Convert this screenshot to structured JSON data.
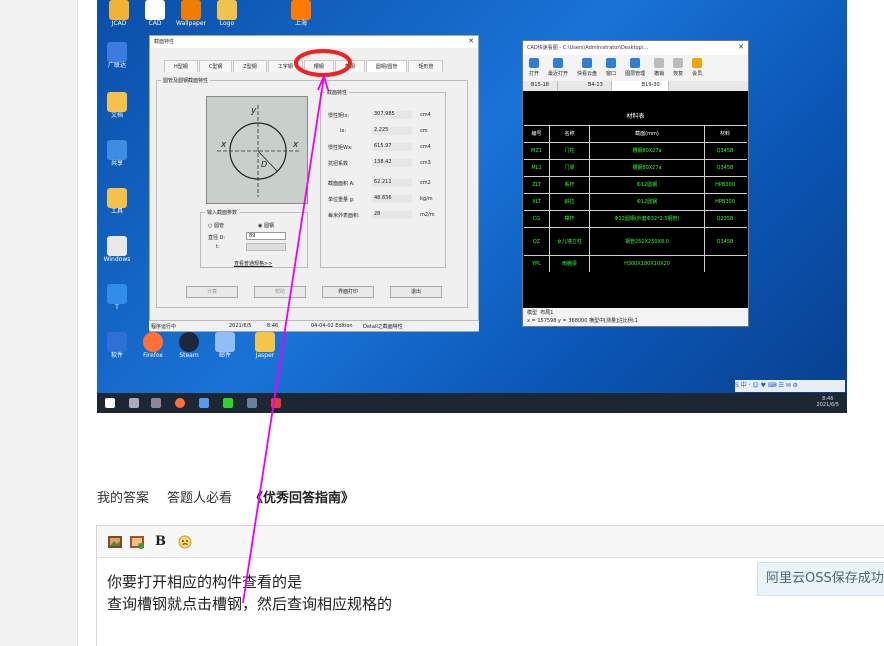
{
  "screenshot": {
    "desktop_icons": [
      {
        "label": "JCAD"
      },
      {
        "label": "CAD"
      },
      {
        "label": "Wallpaper"
      },
      {
        "label": "Logo"
      },
      {
        "label": "上海"
      },
      {
        "label": "广联达"
      },
      {
        "label": "文档"
      },
      {
        "label": "共享"
      },
      {
        "label": "工具"
      },
      {
        "label": "Windows"
      },
      {
        "label": "Ingress"
      },
      {
        "label": "T"
      },
      {
        "label": "软件"
      },
      {
        "label": "Firefox"
      },
      {
        "label": "Steam"
      },
      {
        "label": "邮件"
      },
      {
        "label": "Jasper"
      }
    ],
    "dialog": {
      "title": "截面特性",
      "tabs": [
        "H型钢",
        "C型钢",
        "Z型钢",
        "工字钢",
        "槽钢",
        "角钢",
        "圆钢/圆管",
        "矩形管"
      ],
      "section_group": "圆管及圆钢截面特性",
      "props_group": "截面特性",
      "props": [
        {
          "label": "惯性矩Ix:",
          "value": "307.985",
          "unit": "cm4"
        },
        {
          "label": "ix:",
          "value": "2.225",
          "unit": "cm"
        },
        {
          "label": "惯性矩Wx:",
          "value": "615.97",
          "unit": "cm4"
        },
        {
          "label": "抗扭系数",
          "value": "138.42",
          "unit": "cm3"
        },
        {
          "label": "截面面积 A:",
          "value": "62.211",
          "unit": "cm2"
        },
        {
          "label": "单位重量 g:",
          "value": "48.836",
          "unit": "kg/m"
        },
        {
          "label": "每米外表面积:",
          "value": "28",
          "unit": "m2/m"
        }
      ],
      "input_group": "输入截面参数",
      "radio_pipe": "圆管",
      "radio_bar": "圆钢",
      "diameter_label": "直径 D:",
      "diameter_value": "89",
      "t_label": "t:",
      "link": "查看普通规格>>",
      "buttons": [
        "计算",
        "帮助",
        "界面打印",
        "退出"
      ],
      "status": [
        "程序运行中",
        "2021/6/5",
        "8:46",
        "04-04-02 Edition",
        "Detail之截面特性"
      ]
    },
    "cad": {
      "title": "CAD快速看图 - C:\\Users\\Administrator\\Desktop\\...",
      "tools": [
        "打开",
        "最近打开",
        "快看云盘",
        "窗口",
        "图层管理",
        "撤销",
        "恢复",
        "会员"
      ],
      "tabs": [
        "B15-18",
        "B4-13",
        "B19-30"
      ],
      "table_title": "材料表",
      "headers": [
        "编号",
        "名称",
        "截面(mm)",
        "材料"
      ],
      "rows": [
        [
          "MZ1",
          "门柱",
          "槽钢80X27a",
          "Q345B"
        ],
        [
          "ML1",
          "门梁",
          "槽钢80X27a",
          "Q345B"
        ],
        [
          "ZLT",
          "系杆",
          "Φ12圆钢",
          "HPB300"
        ],
        [
          "XLT",
          "斜拉",
          "Φ12圆钢",
          "HPB300"
        ],
        [
          "CG",
          "撑杆",
          "Φ12圆钢(外套Φ32*2.5钢管)",
          "Q235B"
        ],
        [
          "QZ",
          "女儿墙立柱",
          "钢管250X250X8.0",
          "Q345B"
        ],
        [
          "YPL",
          "雨棚梁",
          "H300X180X10X20",
          ""
        ]
      ],
      "bottom_tabs": [
        "模型",
        "布局1"
      ],
      "coords": "x = 157598 y = 368000 横型中[测量]注比例:1"
    },
    "taskbar": {
      "time": "8:46",
      "date": "2021/6/5"
    }
  },
  "answer_tabs": {
    "my_answer": "我的答案",
    "must_read": "答题人必看",
    "guide": "《优秀回答指南》"
  },
  "editor": {
    "line1": "你要打开相应的构件查看的是",
    "line2": "查询槽钢就点击槽钢，然后查询相应规格的",
    "tools": [
      "image-icon",
      "insert-image-icon",
      "bold-icon",
      "emoji-icon"
    ],
    "bold_label": "B"
  },
  "oss_notice": "阿里云OSS保存成功",
  "annotation_color": "#ee00ee",
  "highlight_color": "#ee2222"
}
